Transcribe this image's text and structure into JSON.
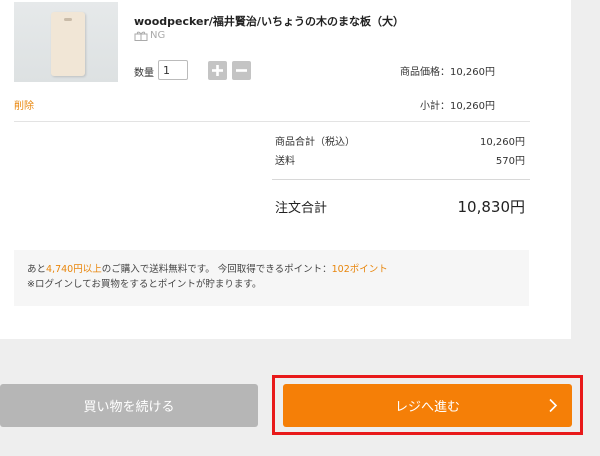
{
  "item": {
    "name": "woodpecker/福井賢治/いちょうの木のまな板（大）",
    "gift_icon": "gift-box-icon",
    "gift_status": "NG",
    "quantity_label": "数量",
    "quantity_value": "1",
    "unit_price": "商品価格：10,260円",
    "delete_label": "削除",
    "subtotal": "小計：10,260円"
  },
  "summary": {
    "goods_total_label": "商品合計（税込）",
    "goods_total_value": "10,260円",
    "shipping_label": "送料",
    "shipping_value": "570円",
    "order_total_label": "注文合計",
    "order_total_value": "10,830円"
  },
  "notice": {
    "line1_prefix": "あと",
    "line1_amount": "4,740円以上",
    "line1_middle": "のご購入で送料無料です。 今回取得できるポイント：",
    "line1_points": "102ポイント",
    "line2": "※ログインしてお買物をするとポイントが貯まります。"
  },
  "buttons": {
    "continue_label": "買い物を続ける",
    "checkout_label": "レジへ進む"
  },
  "colors": {
    "accent": "#e8860c",
    "checkout": "#f57f07",
    "continue": "#b6b6b6",
    "highlight": "#e8191a"
  }
}
